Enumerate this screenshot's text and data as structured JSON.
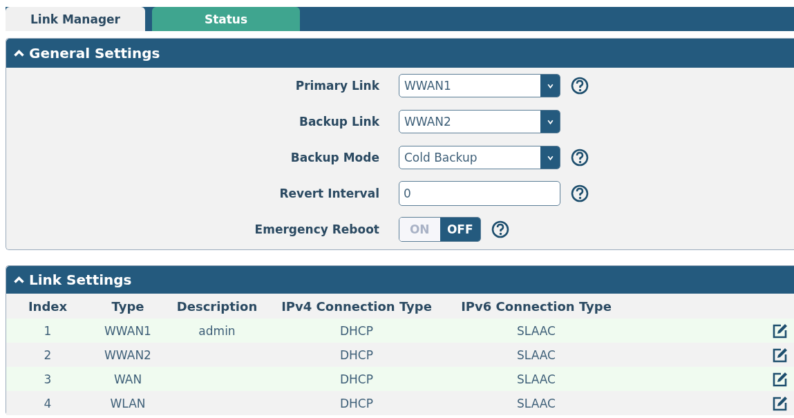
{
  "tabs": [
    {
      "label": "Link Manager",
      "selected": true
    },
    {
      "label": "Status",
      "selected": false
    }
  ],
  "general_settings": {
    "title": "General Settings",
    "expanded": true,
    "fields": [
      {
        "kind": "select",
        "label": "Primary Link",
        "value": "WWAN1",
        "help": true
      },
      {
        "kind": "select",
        "label": "Backup Link",
        "value": "WWAN2",
        "help": false
      },
      {
        "kind": "select",
        "label": "Backup Mode",
        "value": "Cold Backup",
        "help": true
      },
      {
        "kind": "input",
        "label": "Revert Interval",
        "value": "0",
        "help": true
      },
      {
        "kind": "toggle",
        "label": "Emergency Reboot",
        "on": false,
        "on_label": "ON",
        "off_label": "OFF",
        "help": true
      }
    ]
  },
  "link_settings": {
    "title": "Link Settings",
    "expanded": true,
    "columns": [
      "Index",
      "Type",
      "Description",
      "IPv4 Connection Type",
      "IPv6 Connection Type"
    ],
    "rows": [
      {
        "cells": [
          "1",
          "WWAN1",
          "admin",
          "DHCP",
          "SLAAC"
        ]
      },
      {
        "cells": [
          "2",
          "WWAN2",
          "",
          "DHCP",
          "SLAAC"
        ]
      },
      {
        "cells": [
          "3",
          "WAN",
          "",
          "DHCP",
          "SLAAC"
        ]
      },
      {
        "cells": [
          "4",
          "WLAN",
          "",
          "DHCP",
          "SLAAC"
        ]
      }
    ]
  }
}
